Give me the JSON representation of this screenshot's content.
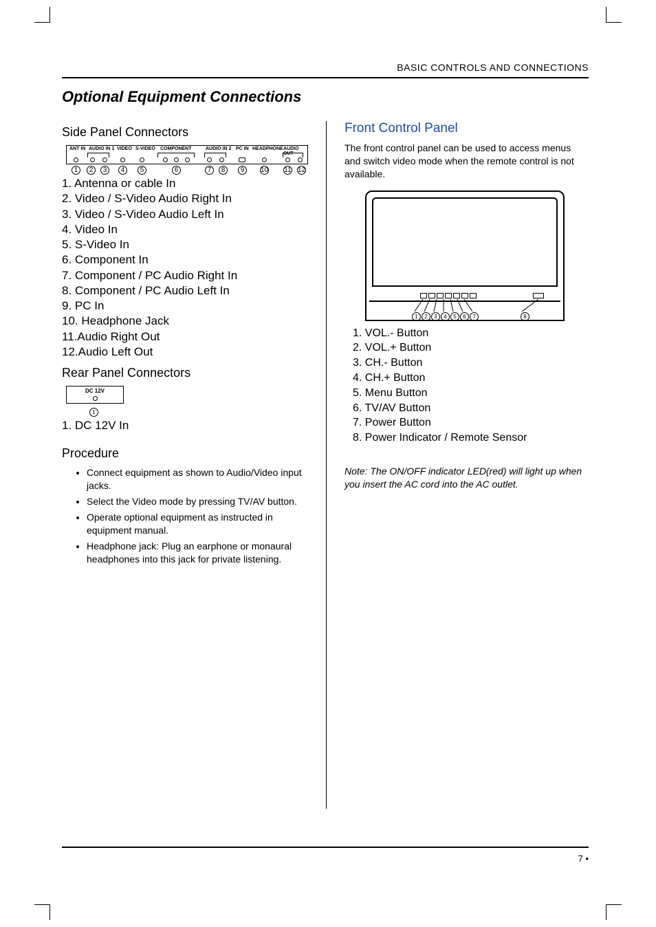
{
  "header": {
    "section": "BASIC CONTROLS AND CONNECTIONS"
  },
  "heading": "Optional Equipment Connections",
  "left": {
    "side_title": "Side Panel Connectors",
    "side_ports": {
      "ant": "ANT IN",
      "audio1": "AUDIO IN 1",
      "video": "VIDEO",
      "svideo": "S-VIDEO",
      "component": "COMPONENT",
      "audio2": "AUDIO IN 2",
      "pcin": "PC IN",
      "headphone": "HEADPHONE",
      "audioout": "AUDIO OUT"
    },
    "side_items": {
      "i1": "1. Antenna or cable In",
      "i2": "2. Video / S-Video Audio Right In",
      "i3": "3. Video / S-Video Audio Left In",
      "i4": "4. Video In",
      "i5": "5. S-Video In",
      "i6": "6. Component In",
      "i7": "7. Component / PC Audio Right In",
      "i8": "8. Component / PC Audio Left In",
      "i9": "9. PC In",
      "i10": "10. Headphone Jack",
      "i11": "11.Audio Right Out",
      "i12": "12.Audio Left Out"
    },
    "rear_title": "Rear  Panel Connectors",
    "rear_label": "DC 12V",
    "rear_item": "1. DC 12V In",
    "procedure_title": "Procedure",
    "proc": {
      "p1": "Connect equipment as shown to  Audio/Video input jacks.",
      "p2": "Select the Video mode by pressing TV/AV button.",
      "p3": "Operate optional equipment as instructed in equipment manual.",
      "p4": "Headphone jack: Plug an earphone or monaural headphones into this jack for private listening."
    }
  },
  "right": {
    "front_title": "Front Control Panel",
    "front_desc": "The front control panel can be used to access menus and switch video mode when the remote control is not available.",
    "front_items": {
      "f1": "1. VOL.- Button",
      "f2": "2. VOL.+ Button",
      "f3": "3. CH.- Button",
      "f4": "4. CH.+ Button",
      "f5": "5. Menu Button",
      "f6": "6. TV/AV Button",
      "f7": "7. Power Button",
      "f8": "8. Power Indicator / Remote Sensor"
    },
    "note": "Note:    The ON/OFF indicator LED(red) will light up when you insert the AC cord into the AC outlet."
  },
  "footer": {
    "page": "7"
  }
}
